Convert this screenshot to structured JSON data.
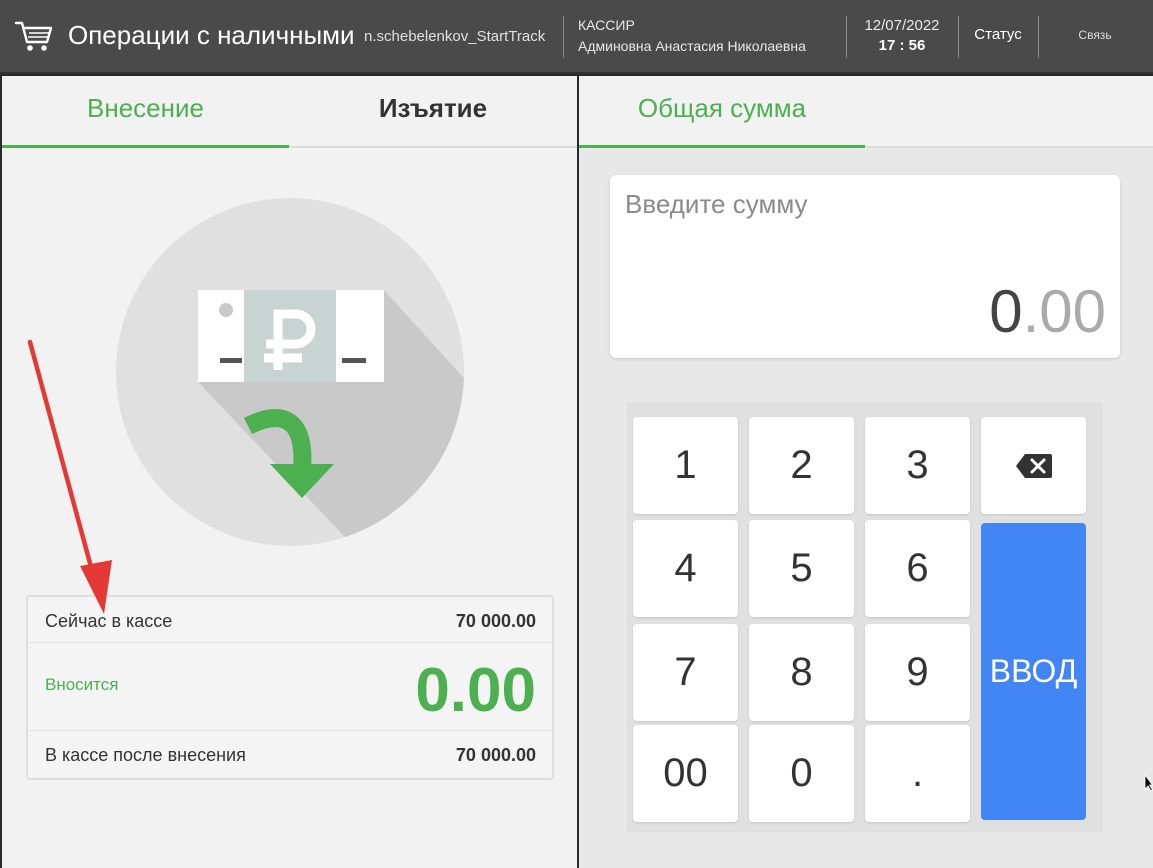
{
  "header": {
    "icon": "cart-icon",
    "title": "Операции с наличными",
    "user_login": "n.schebelenkov_StartTrack",
    "cashier_role": "КАССИР",
    "cashier_name": "Админовна Анастасия Николаевна",
    "date": "12/07/2022",
    "time": "17 : 56",
    "status_label": "Статус",
    "connection_label": "Связь"
  },
  "left": {
    "tabs": [
      {
        "label": "Внесение",
        "active": true
      },
      {
        "label": "Изъятие",
        "active": false
      }
    ],
    "illustration_icon": "cash-deposit-icon",
    "summary": {
      "now_label": "Сейчас в кассе",
      "now_value": "70 000.00",
      "deposit_label": "Вносится",
      "deposit_value": "0.00",
      "after_label": "В кассе после внесения",
      "after_value": "70 000.00"
    }
  },
  "right": {
    "tab_label": "Общая сумма",
    "amount": {
      "placeholder": "Введите сумму",
      "integer": "0",
      "separator": ".",
      "fraction": "00"
    },
    "keypad": {
      "keys": [
        "1",
        "2",
        "3",
        "4",
        "5",
        "6",
        "7",
        "8",
        "9",
        "00",
        "0",
        "."
      ],
      "backspace_icon": "backspace-icon",
      "enter_label": "ВВОД"
    }
  },
  "colors": {
    "accent_green": "#4caf50",
    "enter_blue": "#4285f4",
    "header_bg": "#4a4a4a",
    "annotation_red": "#e53935"
  }
}
